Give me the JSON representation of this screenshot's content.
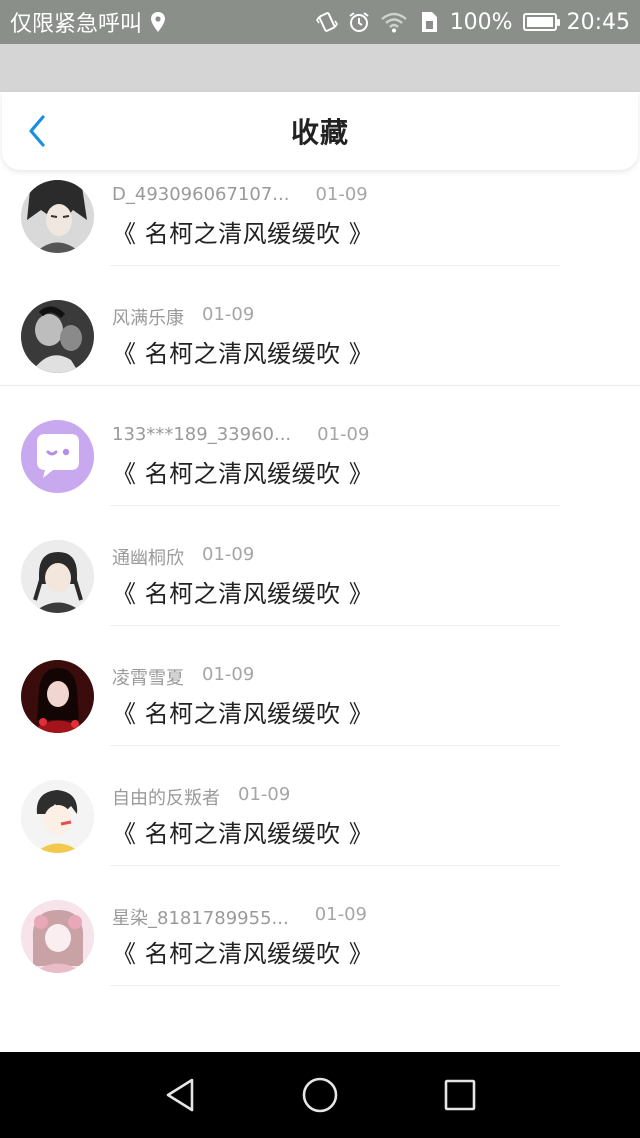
{
  "status_bar": {
    "carrier": "仅限紧急呼叫",
    "battery_percent": "100%",
    "time": "20:45",
    "battery_level": 1.0,
    "icons": [
      "location-icon",
      "vibrate-icon",
      "alarm-icon",
      "wifi-icon",
      "sim-icon",
      "battery-icon"
    ]
  },
  "header": {
    "title": "收藏",
    "back_icon": "chevron-left-icon",
    "accent_color": "#1a8fe0"
  },
  "favorites": [
    {
      "name": "",
      "date": "",
      "title": "《 名柯之清风缓缓吹 》"
    },
    {
      "name": "D_493096067107...",
      "date": "01-09",
      "title": "《 名柯之清风缓缓吹 》"
    },
    {
      "name": "风满乐康",
      "date": "01-09",
      "title": "《 名柯之清风缓缓吹 》"
    },
    {
      "name": "133***189_33960...",
      "date": "01-09",
      "title": "《 名柯之清风缓缓吹 》"
    },
    {
      "name": "通幽桐欣",
      "date": "01-09",
      "title": "《 名柯之清风缓缓吹 》"
    },
    {
      "name": "凌霄雪夏",
      "date": "01-09",
      "title": "《 名柯之清风缓缓吹 》"
    },
    {
      "name": "自由的反叛者",
      "date": "01-09",
      "title": "《 名柯之清风缓缓吹 》"
    },
    {
      "name": "星染_8181789955...",
      "date": "01-09",
      "title": "《 名柯之清风缓缓吹 》"
    }
  ],
  "nav_bar": {
    "icons": [
      "back-triangle-icon",
      "home-circle-icon",
      "recents-square-icon"
    ]
  }
}
